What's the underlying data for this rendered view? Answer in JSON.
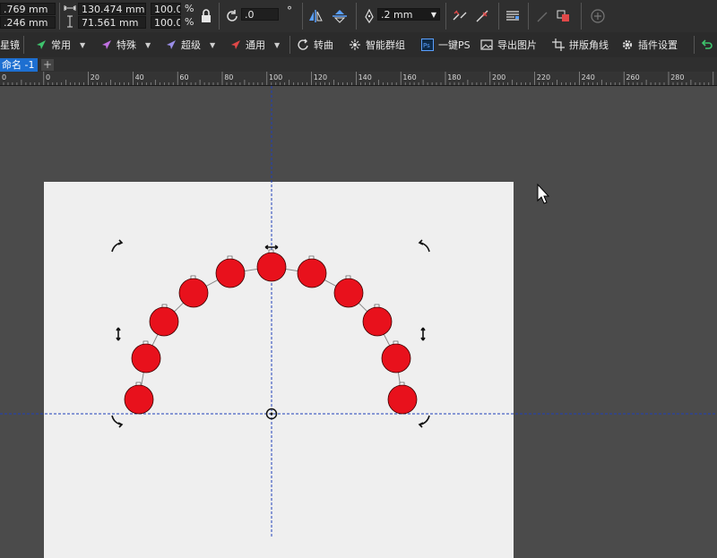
{
  "property_bar": {
    "x_value": ".769 mm",
    "y_value": ".246 mm",
    "width_value": "130.474 mm",
    "height_value": "71.561 mm",
    "scale_x": "100.0",
    "scale_y": "100.0",
    "percent_symbol": "%",
    "rotation_value": ".0",
    "degree_symbol": "°",
    "outline_width": ".2 mm"
  },
  "plugin_bar": {
    "items": [
      {
        "label": "星镜",
        "icon": "mirror-icon"
      },
      {
        "label": "常用",
        "icon": "arrow-green-icon",
        "color": "#3ec46d"
      },
      {
        "label": "特殊",
        "icon": "arrow-purple-icon",
        "color": "#c070e0"
      },
      {
        "label": "超级",
        "icon": "arrow-lavender-icon",
        "color": "#9a8ee8"
      },
      {
        "label": "通用",
        "icon": "arrow-red-icon",
        "color": "#e04848"
      },
      {
        "label": "转曲",
        "icon": "curve-icon"
      },
      {
        "label": "智能群组",
        "icon": "group-icon"
      },
      {
        "label": "一键PS",
        "icon": "ps-icon"
      },
      {
        "label": "导出图片",
        "icon": "image-export-icon"
      },
      {
        "label": "拼版角线",
        "icon": "crop-marks-icon"
      },
      {
        "label": "插件设置",
        "icon": "gear-icon"
      }
    ]
  },
  "tabs": {
    "document_tab": "命名 -1",
    "add_tab": "+"
  },
  "ruler": {
    "labels": [
      "0",
      "0",
      "20",
      "40",
      "60",
      "80",
      "100",
      "120",
      "140",
      "160",
      "180",
      "200",
      "220",
      "240",
      "260",
      "280"
    ]
  },
  "colors": {
    "circle_fill": "#e8111c",
    "page": "#efefef",
    "desktop": "#4b4b4b",
    "guide": "#1f3fb8",
    "tab_active": "#1d6fd1"
  }
}
